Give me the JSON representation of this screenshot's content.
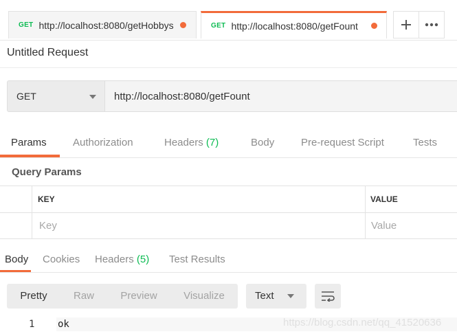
{
  "tabs": [
    {
      "method": "GET",
      "url": "http://localhost:8080/getHobbys",
      "active": false
    },
    {
      "method": "GET",
      "url": "http://localhost:8080/getFount",
      "active": true
    }
  ],
  "tab_controls": {
    "new_tab_icon": "plus-icon",
    "more_icon": "ellipsis-icon"
  },
  "request": {
    "title": "Untitled Request",
    "method": "GET",
    "url": "http://localhost:8080/getFount"
  },
  "request_tabs": [
    {
      "label": "Params",
      "active": true
    },
    {
      "label": "Authorization"
    },
    {
      "label": "Headers",
      "count": "(7)"
    },
    {
      "label": "Body"
    },
    {
      "label": "Pre-request Script"
    },
    {
      "label": "Tests"
    }
  ],
  "query_params": {
    "title": "Query Params",
    "key_header": "KEY",
    "value_header": "VALUE",
    "key_placeholder": "Key",
    "value_placeholder": "Value"
  },
  "response_tabs": [
    {
      "label": "Body",
      "active": true
    },
    {
      "label": "Cookies"
    },
    {
      "label": "Headers",
      "count": "(5)"
    },
    {
      "label": "Test Results"
    }
  ],
  "response_toolbar": {
    "formats": [
      "Pretty",
      "Raw",
      "Preview",
      "Visualize"
    ],
    "active_format": "Pretty",
    "language": "Text",
    "wrap_icon": "wrap-lines-icon"
  },
  "response_body": {
    "lines": [
      {
        "number": "1",
        "text": "ok"
      }
    ]
  },
  "watermark": "https://blog.csdn.net/qq_41520636",
  "colors": {
    "accent": "#f26b3a",
    "method_get": "#0cbb52"
  }
}
